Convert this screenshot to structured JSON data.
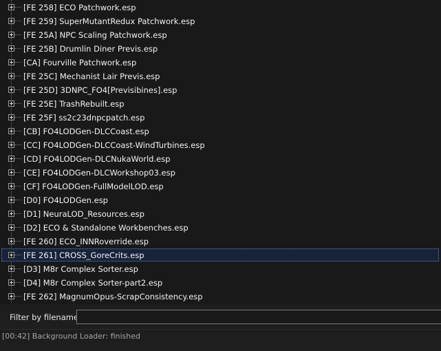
{
  "tree": {
    "items": [
      {
        "label": "[FE 258] ECO Patchwork.esp"
      },
      {
        "label": "[FE 259] SuperMutantRedux Patchwork.esp"
      },
      {
        "label": "[FE 25A] NPC Scaling Patchwork.esp"
      },
      {
        "label": "[FE 25B] Drumlin Diner Previs.esp"
      },
      {
        "label": "[CA] Fourville Patchwork.esp"
      },
      {
        "label": "[FE 25C] Mechanist Lair Previs.esp"
      },
      {
        "label": "[FE 25D] 3DNPC_FO4[Previsibines].esp"
      },
      {
        "label": "[FE 25E] TrashRebuilt.esp"
      },
      {
        "label": "[FE 25F] ss2c23dnpcpatch.esp"
      },
      {
        "label": "[CB] FO4LODGen-DLCCoast.esp"
      },
      {
        "label": "[CC] FO4LODGen-DLCCoast-WindTurbines.esp"
      },
      {
        "label": "[CD] FO4LODGen-DLCNukaWorld.esp"
      },
      {
        "label": "[CE] FO4LODGen-DLCWorkshop03.esp"
      },
      {
        "label": "[CF] FO4LODGen-FullModelLOD.esp"
      },
      {
        "label": "[D0] FO4LODGen.esp"
      },
      {
        "label": "[D1] NeuraLOD_Resources.esp"
      },
      {
        "label": "[D2] ECO & Standalone Workbenches.esp"
      },
      {
        "label": "[FE 260] ECO_INNRoverride.esp"
      },
      {
        "label": "[FE 261] CROSS_GoreCrits.esp",
        "selected": true
      },
      {
        "label": "[D3] M8r Complex Sorter.esp"
      },
      {
        "label": "[D4] M8r Complex Sorter-part2.esp"
      },
      {
        "label": "[FE 262] MagnumOpus-ScrapConsistency.esp"
      }
    ]
  },
  "filter": {
    "label": "Filter by filename:",
    "value": "",
    "placeholder": ""
  },
  "status": {
    "text": "[00:42] Background Loader: finished"
  },
  "colors": {
    "tree_bg": "#191919",
    "selection_bg": "#16233a",
    "status_text": "#a6a6a6"
  },
  "icons": {
    "expander": "plus-box-icon"
  }
}
